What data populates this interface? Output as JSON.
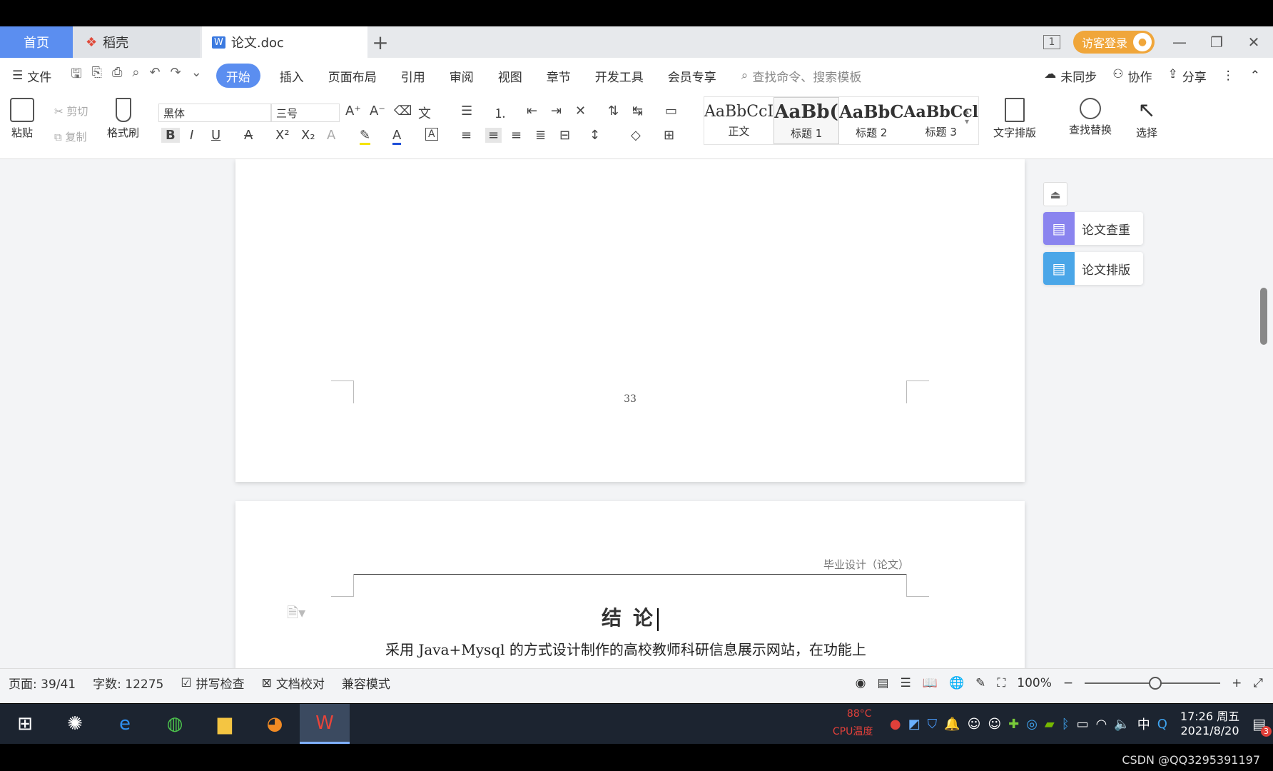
{
  "titlebar": {
    "tabs": [
      {
        "label": "首页",
        "icon": "home"
      },
      {
        "label": "稻壳",
        "icon": "daoke-icon"
      },
      {
        "label": "论文.doc",
        "icon": "word-doc-icon"
      }
    ],
    "new_tab": "+",
    "page_count_badge": "1",
    "login_label": "访客登录"
  },
  "menubar": {
    "file": "文件",
    "items": [
      "开始",
      "插入",
      "页面布局",
      "引用",
      "审阅",
      "视图",
      "章节",
      "开发工具",
      "会员专享"
    ],
    "search_placeholder": "查找命令、搜索模板",
    "sync": "未同步",
    "collab": "协作",
    "share": "分享"
  },
  "ribbon": {
    "paste": "粘贴",
    "cut": "剪切",
    "copy": "复制",
    "format_painter": "格式刷",
    "font_name": "黑体",
    "font_size": "三号",
    "styles": [
      {
        "preview": "AaBbCcI",
        "label": "正文"
      },
      {
        "preview": "AaBb(",
        "label": "标题 1"
      },
      {
        "preview": "AaBbC",
        "label": "标题 2"
      },
      {
        "preview": "AaBbCcl",
        "label": "标题 3"
      }
    ],
    "text_layout": "文字排版",
    "find_replace": "查找替换",
    "select": "选择"
  },
  "document": {
    "page_number": "33",
    "header_note": "毕业设计（论文）",
    "chapter_title": "结论",
    "body_line": "采用 Java+Mysql 的方式设计制作的高校教师科研信息展示网站，在功能上"
  },
  "side_panel": {
    "thesis_check": "论文查重",
    "thesis_format": "论文排版"
  },
  "statusbar": {
    "page": "页面: 39/41",
    "word_count": "字数: 12275",
    "spell_check": "拼写检查",
    "doc_proof": "文档校对",
    "compat": "兼容模式",
    "zoom": "100%",
    "zoom_level_percent": 100
  },
  "taskbar": {
    "cpu_temp": "88°C",
    "cpu_label": "CPU温度",
    "ime": "中",
    "time": "17:26 周五",
    "date": "2021/8/20",
    "notify_count": "3"
  },
  "watermark": "CSDN @QQ3295391197",
  "colors": {
    "accent": "#5b8ef0",
    "login": "#f0a63a",
    "taskbar": "#1c2430"
  }
}
